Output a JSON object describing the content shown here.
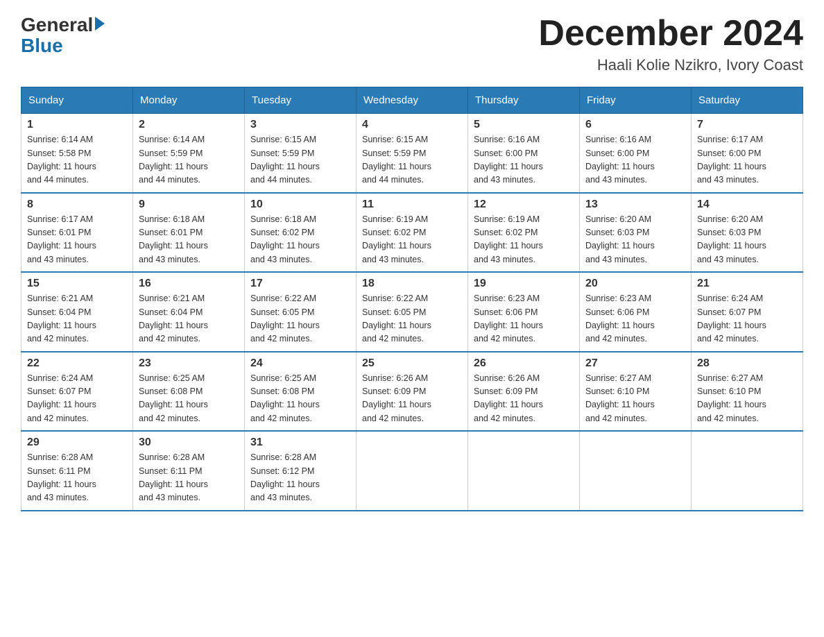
{
  "header": {
    "logo_general": "General",
    "logo_blue": "Blue",
    "month_title": "December 2024",
    "location": "Haali Kolie Nzikro, Ivory Coast"
  },
  "days_of_week": [
    "Sunday",
    "Monday",
    "Tuesday",
    "Wednesday",
    "Thursday",
    "Friday",
    "Saturday"
  ],
  "weeks": [
    [
      {
        "day": "1",
        "sunrise": "6:14 AM",
        "sunset": "5:58 PM",
        "daylight": "11 hours and 44 minutes."
      },
      {
        "day": "2",
        "sunrise": "6:14 AM",
        "sunset": "5:59 PM",
        "daylight": "11 hours and 44 minutes."
      },
      {
        "day": "3",
        "sunrise": "6:15 AM",
        "sunset": "5:59 PM",
        "daylight": "11 hours and 44 minutes."
      },
      {
        "day": "4",
        "sunrise": "6:15 AM",
        "sunset": "5:59 PM",
        "daylight": "11 hours and 44 minutes."
      },
      {
        "day": "5",
        "sunrise": "6:16 AM",
        "sunset": "6:00 PM",
        "daylight": "11 hours and 43 minutes."
      },
      {
        "day": "6",
        "sunrise": "6:16 AM",
        "sunset": "6:00 PM",
        "daylight": "11 hours and 43 minutes."
      },
      {
        "day": "7",
        "sunrise": "6:17 AM",
        "sunset": "6:00 PM",
        "daylight": "11 hours and 43 minutes."
      }
    ],
    [
      {
        "day": "8",
        "sunrise": "6:17 AM",
        "sunset": "6:01 PM",
        "daylight": "11 hours and 43 minutes."
      },
      {
        "day": "9",
        "sunrise": "6:18 AM",
        "sunset": "6:01 PM",
        "daylight": "11 hours and 43 minutes."
      },
      {
        "day": "10",
        "sunrise": "6:18 AM",
        "sunset": "6:02 PM",
        "daylight": "11 hours and 43 minutes."
      },
      {
        "day": "11",
        "sunrise": "6:19 AM",
        "sunset": "6:02 PM",
        "daylight": "11 hours and 43 minutes."
      },
      {
        "day": "12",
        "sunrise": "6:19 AM",
        "sunset": "6:02 PM",
        "daylight": "11 hours and 43 minutes."
      },
      {
        "day": "13",
        "sunrise": "6:20 AM",
        "sunset": "6:03 PM",
        "daylight": "11 hours and 43 minutes."
      },
      {
        "day": "14",
        "sunrise": "6:20 AM",
        "sunset": "6:03 PM",
        "daylight": "11 hours and 43 minutes."
      }
    ],
    [
      {
        "day": "15",
        "sunrise": "6:21 AM",
        "sunset": "6:04 PM",
        "daylight": "11 hours and 42 minutes."
      },
      {
        "day": "16",
        "sunrise": "6:21 AM",
        "sunset": "6:04 PM",
        "daylight": "11 hours and 42 minutes."
      },
      {
        "day": "17",
        "sunrise": "6:22 AM",
        "sunset": "6:05 PM",
        "daylight": "11 hours and 42 minutes."
      },
      {
        "day": "18",
        "sunrise": "6:22 AM",
        "sunset": "6:05 PM",
        "daylight": "11 hours and 42 minutes."
      },
      {
        "day": "19",
        "sunrise": "6:23 AM",
        "sunset": "6:06 PM",
        "daylight": "11 hours and 42 minutes."
      },
      {
        "day": "20",
        "sunrise": "6:23 AM",
        "sunset": "6:06 PM",
        "daylight": "11 hours and 42 minutes."
      },
      {
        "day": "21",
        "sunrise": "6:24 AM",
        "sunset": "6:07 PM",
        "daylight": "11 hours and 42 minutes."
      }
    ],
    [
      {
        "day": "22",
        "sunrise": "6:24 AM",
        "sunset": "6:07 PM",
        "daylight": "11 hours and 42 minutes."
      },
      {
        "day": "23",
        "sunrise": "6:25 AM",
        "sunset": "6:08 PM",
        "daylight": "11 hours and 42 minutes."
      },
      {
        "day": "24",
        "sunrise": "6:25 AM",
        "sunset": "6:08 PM",
        "daylight": "11 hours and 42 minutes."
      },
      {
        "day": "25",
        "sunrise": "6:26 AM",
        "sunset": "6:09 PM",
        "daylight": "11 hours and 42 minutes."
      },
      {
        "day": "26",
        "sunrise": "6:26 AM",
        "sunset": "6:09 PM",
        "daylight": "11 hours and 42 minutes."
      },
      {
        "day": "27",
        "sunrise": "6:27 AM",
        "sunset": "6:10 PM",
        "daylight": "11 hours and 42 minutes."
      },
      {
        "day": "28",
        "sunrise": "6:27 AM",
        "sunset": "6:10 PM",
        "daylight": "11 hours and 42 minutes."
      }
    ],
    [
      {
        "day": "29",
        "sunrise": "6:28 AM",
        "sunset": "6:11 PM",
        "daylight": "11 hours and 43 minutes."
      },
      {
        "day": "30",
        "sunrise": "6:28 AM",
        "sunset": "6:11 PM",
        "daylight": "11 hours and 43 minutes."
      },
      {
        "day": "31",
        "sunrise": "6:28 AM",
        "sunset": "6:12 PM",
        "daylight": "11 hours and 43 minutes."
      },
      null,
      null,
      null,
      null
    ]
  ],
  "labels": {
    "sunrise": "Sunrise:",
    "sunset": "Sunset:",
    "daylight": "Daylight:"
  }
}
